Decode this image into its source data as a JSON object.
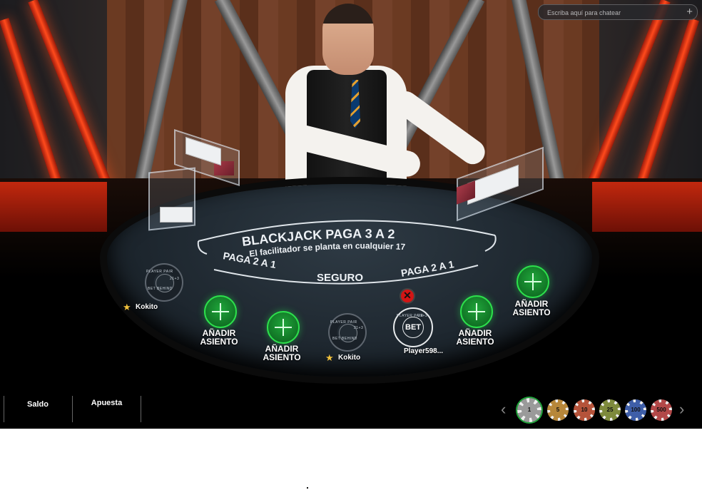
{
  "chat": {
    "placeholder": "Escriba aquí para chatear",
    "send_icon": "plus-icon"
  },
  "table": {
    "title": "BLACKJACK PAGA 3 A 2",
    "subtitle": "El facilitador se planta en cualquier 17",
    "insurance": "SEGURO",
    "pays_left": "PAGA 2 A 1",
    "pays_right": "PAGA 2 A 1"
  },
  "seats": {
    "add_label_line1": "AÑADIR",
    "add_label_line2": "ASIENTO",
    "side_bet_top": "PLAYER PAIR",
    "side_bet_right": "21+3",
    "side_bet_bottom": "BET BEHIND",
    "bet_label": "BET",
    "player_names": [
      "Kokito",
      "Kokito",
      "Player598..."
    ]
  },
  "bottom_bar": {
    "balance_label": "Saldo",
    "bet_label": "Apuesta",
    "chips": [
      {
        "value": "1",
        "color": "#9a9a9a",
        "selected": true
      },
      {
        "value": "5",
        "color": "#b7873a"
      },
      {
        "value": "10",
        "color": "#b5533a"
      },
      {
        "value": "25",
        "color": "#7e8a3c"
      },
      {
        "value": "100",
        "color": "#3e5ea8"
      },
      {
        "value": "500",
        "color": "#b24848"
      }
    ]
  },
  "colors": {
    "accent_green": "#2de04c",
    "close_red": "#d31515"
  }
}
